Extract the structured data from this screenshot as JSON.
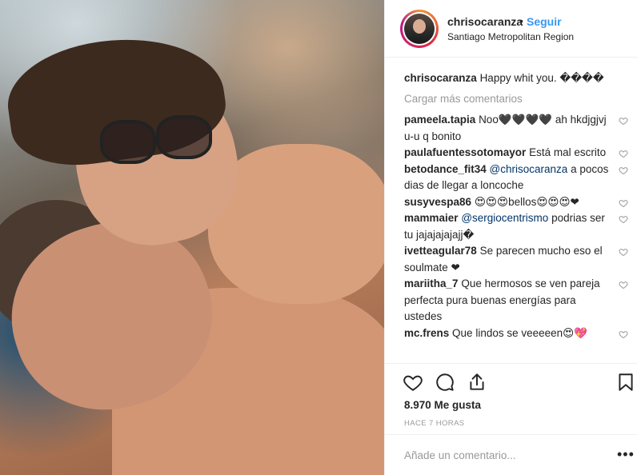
{
  "post": {
    "username": "chrisocaranza",
    "separator": "•",
    "follow_label": "Seguir",
    "location": "Santiago Metropolitan Region"
  },
  "caption": {
    "username": "chrisocaranza",
    "text": "Happy whit you. ����"
  },
  "load_more_label": "Cargar más comentarios",
  "comments": [
    {
      "user": "pameela.tapia",
      "mention": "",
      "text": "Noo🖤🖤🖤🖤 ah hkdjgjvj u-u q bonito"
    },
    {
      "user": "paulafuentessotomayor",
      "mention": "",
      "text": "Está mal escrito"
    },
    {
      "user": "betodance_fit34",
      "mention": "@chrisocaranza",
      "text": "a pocos dias de llegar a loncoche"
    },
    {
      "user": "susyvespa86",
      "mention": "",
      "text": "😍😍😍bellos😍😍😍❤"
    },
    {
      "user": "mammaier",
      "mention": "@sergiocentrismo",
      "text": "podrias ser tu jajajajajajj�"
    },
    {
      "user": "ivetteagular78",
      "mention": "",
      "text": "Se parecen mucho eso el soulmate ❤"
    },
    {
      "user": "mariitha_7",
      "mention": "",
      "text": "Que hermosos se ven pareja perfecta pura buenas energías para ustedes"
    },
    {
      "user": "mc.frens",
      "mention": "",
      "text": "Que lindos se veeeeen😍💖"
    }
  ],
  "likes_text": "8.970 Me gusta",
  "time_text": "HACE 7 HORAS",
  "add_comment_placeholder": "Añade un comentario...",
  "more_label": "•••",
  "icons": {
    "like": "heart-icon",
    "comment": "comment-icon",
    "share": "share-icon",
    "save": "bookmark-icon",
    "comment_like": "heart-icon",
    "options": "more-icon"
  },
  "colors": {
    "follow": "#3897f0",
    "mention": "#003569",
    "muted": "#999999",
    "text": "#262626"
  }
}
